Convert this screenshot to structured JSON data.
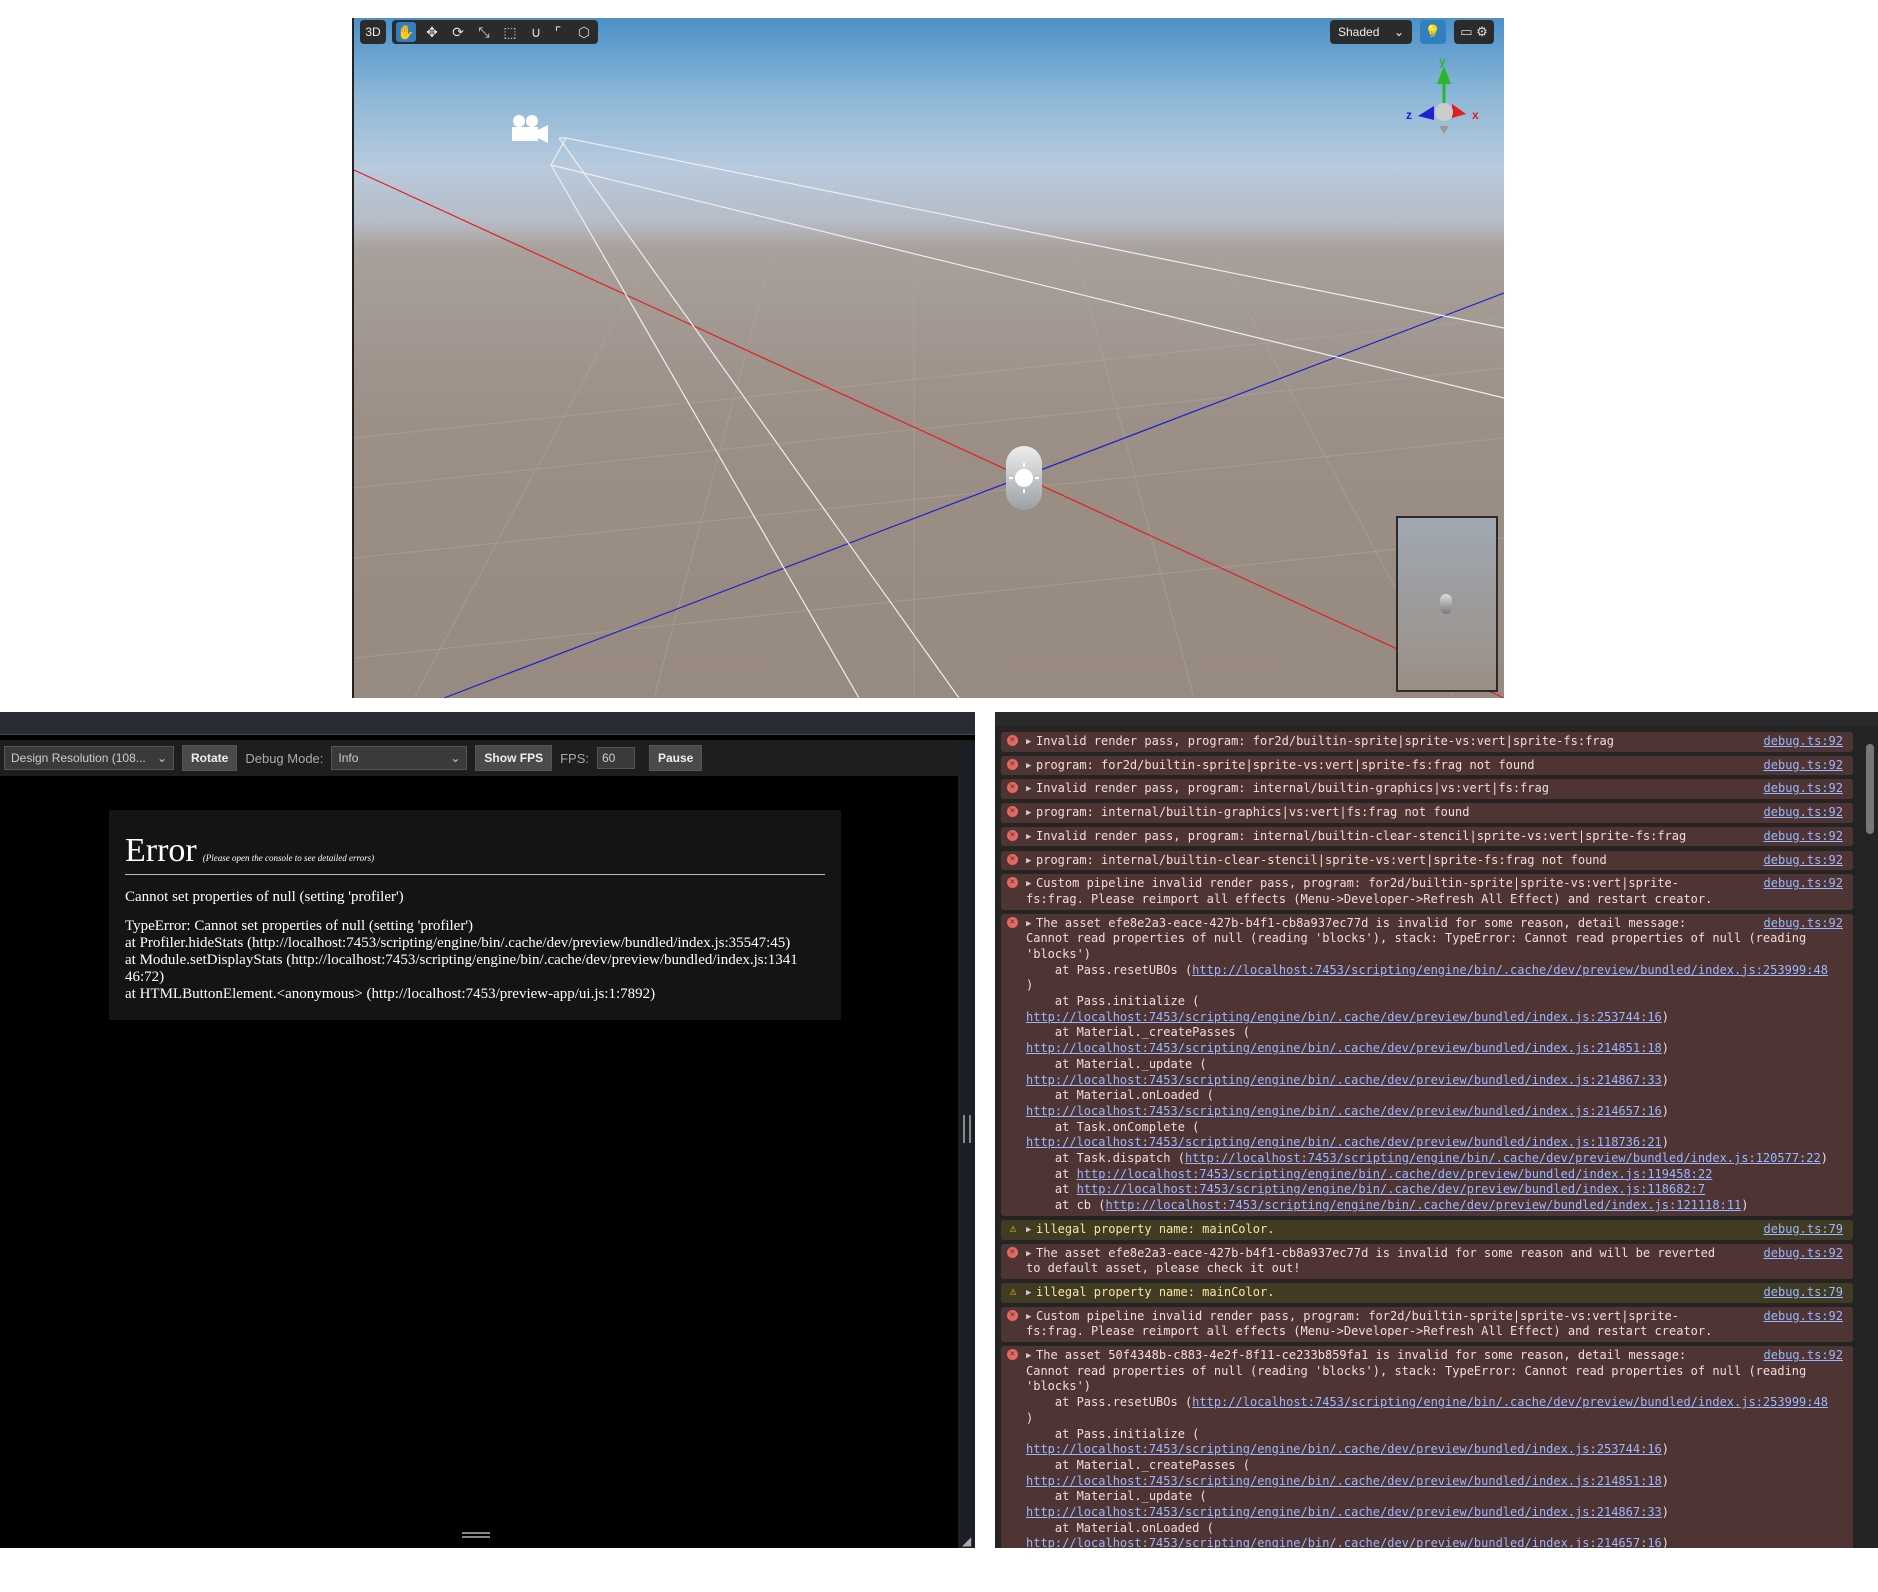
{
  "scene": {
    "mode_label": "3D",
    "shading_label": "Shaded",
    "gizmo_axes": {
      "x": "x",
      "y": "y",
      "z": "z"
    },
    "toolbar_icons": [
      "hand-icon",
      "move-icon",
      "rotate-icon",
      "scale-icon",
      "rect-icon",
      "magnet-icon"
    ],
    "colors": {
      "x_axis": "#e02020",
      "z_axis": "#2020d0",
      "accent": "#2f7fc1"
    }
  },
  "preview": {
    "design_resolution": "Design Resolution (108...",
    "rotate_label": "Rotate",
    "debug_mode_label": "Debug Mode:",
    "debug_mode_value": "Info",
    "show_fps_label": "Show FPS",
    "fps_label": "FPS:",
    "fps_value": "60",
    "pause_label": "Pause",
    "error": {
      "title": "Error",
      "hint": "(Please open the console to see detailed errors)",
      "message": "Cannot set properties of null (setting 'profiler')",
      "stack": [
        "TypeError: Cannot set properties of null (setting 'profiler')",
        "at Profiler.hideStats (http://localhost:7453/scripting/engine/bin/.cache/dev/preview/bundled/index.js:35547:45)",
        "at Module.setDisplayStats (http://localhost:7453/scripting/engine/bin/.cache/dev/preview/bundled/index.js:1341",
        "46:72)",
        "at HTMLButtonElement.<anonymous> (http://localhost:7453/preview-app/ui.js:1:7892)"
      ]
    }
  },
  "console": {
    "rows": [
      {
        "type": "error",
        "lines": [
          "Invalid render pass, program: for2d/builtin-sprite|sprite-vs:vert|sprite-fs:frag"
        ],
        "source": "debug.ts:92"
      },
      {
        "type": "error",
        "lines": [
          "program: for2d/builtin-sprite|sprite-vs:vert|sprite-fs:frag not found"
        ],
        "source": "debug.ts:92"
      },
      {
        "type": "error",
        "lines": [
          "Invalid render pass, program: internal/builtin-graphics|vs:vert|fs:frag"
        ],
        "source": "debug.ts:92"
      },
      {
        "type": "error",
        "lines": [
          "program: internal/builtin-graphics|vs:vert|fs:frag not found"
        ],
        "source": "debug.ts:92"
      },
      {
        "type": "error",
        "lines": [
          "Invalid render pass, program: internal/builtin-clear-stencil|sprite-vs:vert|sprite-fs:frag"
        ],
        "source": "debug.ts:92"
      },
      {
        "type": "error",
        "lines": [
          "program: internal/builtin-clear-stencil|sprite-vs:vert|sprite-fs:frag not found"
        ],
        "source": "debug.ts:92"
      },
      {
        "type": "error",
        "lines": [
          "Custom pipeline invalid render pass, program: for2d/builtin-sprite|sprite-vs:vert|sprite-",
          "fs:frag. Please reimport all effects (Menu->Developer->Refresh All Effect) and restart creator."
        ],
        "source": "debug.ts:92"
      },
      {
        "type": "error",
        "lines": [
          "The asset efe8e2a3-eace-427b-b4f1-cb8a937ec77d is invalid for some reason, detail message:",
          "Cannot read properties of null (reading 'blocks'), stack: TypeError: Cannot read properties of null (reading",
          "'blocks')",
          "    at Pass.resetUBOs (http://localhost:7453/scripting/engine/bin/.cache/dev/preview/bundled/index.js:253999:48",
          ")",
          "    at Pass.initialize (",
          "http://localhost:7453/scripting/engine/bin/.cache/dev/preview/bundled/index.js:253744:16)",
          "    at Material._createPasses (",
          "http://localhost:7453/scripting/engine/bin/.cache/dev/preview/bundled/index.js:214851:18)",
          "    at Material._update (",
          "http://localhost:7453/scripting/engine/bin/.cache/dev/preview/bundled/index.js:214867:33)",
          "    at Material.onLoaded (",
          "http://localhost:7453/scripting/engine/bin/.cache/dev/preview/bundled/index.js:214657:16)",
          "    at Task.onComplete (",
          "http://localhost:7453/scripting/engine/bin/.cache/dev/preview/bundled/index.js:118736:21)",
          "    at Task.dispatch (http://localhost:7453/scripting/engine/bin/.cache/dev/preview/bundled/index.js:120577:22)",
          "    at http://localhost:7453/scripting/engine/bin/.cache/dev/preview/bundled/index.js:119458:22",
          "    at http://localhost:7453/scripting/engine/bin/.cache/dev/preview/bundled/index.js:118682:7",
          "    at cb (http://localhost:7453/scripting/engine/bin/.cache/dev/preview/bundled/index.js:121118:11)"
        ],
        "source": "debug.ts:92"
      },
      {
        "type": "warn",
        "lines": [
          "illegal property name: mainColor."
        ],
        "source": "debug.ts:79"
      },
      {
        "type": "error",
        "lines": [
          "The asset efe8e2a3-eace-427b-b4f1-cb8a937ec77d is invalid for some reason and will be reverted",
          "to default asset, please check it out!"
        ],
        "source": "debug.ts:92"
      },
      {
        "type": "warn",
        "lines": [
          "illegal property name: mainColor."
        ],
        "source": "debug.ts:79"
      },
      {
        "type": "error",
        "lines": [
          "Custom pipeline invalid render pass, program: for2d/builtin-sprite|sprite-vs:vert|sprite-",
          "fs:frag. Please reimport all effects (Menu->Developer->Refresh All Effect) and restart creator."
        ],
        "source": "debug.ts:92"
      },
      {
        "type": "error",
        "lines": [
          "The asset 50f4348b-c883-4e2f-8f11-ce233b859fa1 is invalid for some reason, detail message:",
          "Cannot read properties of null (reading 'blocks'), stack: TypeError: Cannot read properties of null (reading",
          "'blocks')",
          "    at Pass.resetUBOs (http://localhost:7453/scripting/engine/bin/.cache/dev/preview/bundled/index.js:253999:48",
          ")",
          "    at Pass.initialize (",
          "http://localhost:7453/scripting/engine/bin/.cache/dev/preview/bundled/index.js:253744:16)",
          "    at Material._createPasses (",
          "http://localhost:7453/scripting/engine/bin/.cache/dev/preview/bundled/index.js:214851:18)",
          "    at Material._update (",
          "http://localhost:7453/scripting/engine/bin/.cache/dev/preview/bundled/index.js:214867:33)",
          "    at Material.onLoaded (",
          "http://localhost:7453/scripting/engine/bin/.cache/dev/preview/bundled/index.js:214657:16)"
        ],
        "source": "debug.ts:92"
      }
    ]
  }
}
